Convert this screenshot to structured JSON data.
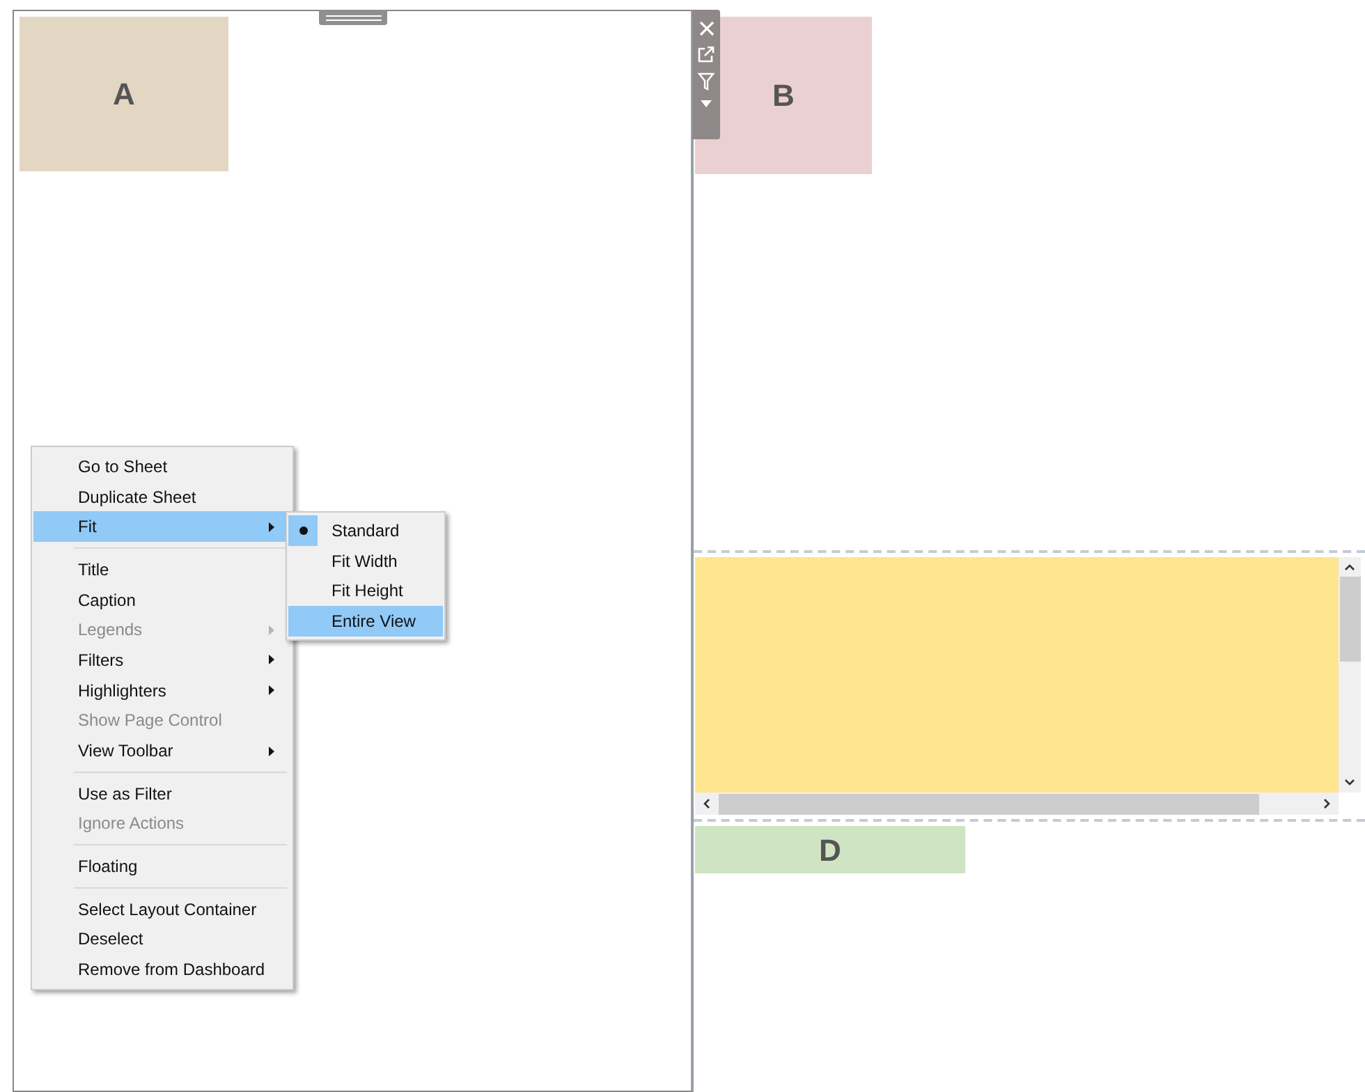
{
  "tiles": [
    {
      "label": "A",
      "color": "#e3d6c2"
    },
    {
      "label": "B",
      "color": "#ebd0d1"
    },
    {
      "label": "D",
      "color": "#cfe4c3"
    }
  ],
  "yellow_view": {
    "color": "#fee590"
  },
  "context_menu": [
    {
      "kind": "item",
      "label": "Go to Sheet",
      "disabled": false,
      "submenu": false,
      "selected": false
    },
    {
      "kind": "item",
      "label": "Duplicate Sheet",
      "disabled": false,
      "submenu": false,
      "selected": false
    },
    {
      "kind": "item",
      "label": "Fit",
      "disabled": false,
      "submenu": true,
      "selected": true
    },
    {
      "kind": "separator"
    },
    {
      "kind": "item",
      "label": "Title",
      "disabled": false,
      "submenu": false,
      "selected": false
    },
    {
      "kind": "item",
      "label": "Caption",
      "disabled": false,
      "submenu": false,
      "selected": false
    },
    {
      "kind": "item",
      "label": "Legends",
      "disabled": true,
      "submenu": true,
      "selected": false
    },
    {
      "kind": "item",
      "label": "Filters",
      "disabled": false,
      "submenu": true,
      "selected": false
    },
    {
      "kind": "item",
      "label": "Highlighters",
      "disabled": false,
      "submenu": true,
      "selected": false
    },
    {
      "kind": "item",
      "label": "Show Page Control",
      "disabled": true,
      "submenu": false,
      "selected": false
    },
    {
      "kind": "item",
      "label": "View Toolbar",
      "disabled": false,
      "submenu": true,
      "selected": false
    },
    {
      "kind": "separator"
    },
    {
      "kind": "item",
      "label": "Use as Filter",
      "disabled": false,
      "submenu": false,
      "selected": false
    },
    {
      "kind": "item",
      "label": "Ignore Actions",
      "disabled": true,
      "submenu": false,
      "selected": false
    },
    {
      "kind": "separator"
    },
    {
      "kind": "item",
      "label": "Floating",
      "disabled": false,
      "submenu": false,
      "selected": false
    },
    {
      "kind": "separator"
    },
    {
      "kind": "item",
      "label": "Select Layout Container",
      "disabled": false,
      "submenu": false,
      "selected": false
    },
    {
      "kind": "item",
      "label": "Deselect",
      "disabled": false,
      "submenu": false,
      "selected": false
    },
    {
      "kind": "item",
      "label": "Remove from Dashboard",
      "disabled": false,
      "submenu": false,
      "selected": false
    }
  ],
  "fit_submenu": [
    {
      "label": "Standard",
      "checked": true,
      "selected": false
    },
    {
      "label": "Fit Width",
      "checked": false,
      "selected": false
    },
    {
      "label": "Fit Height",
      "checked": false,
      "selected": false
    },
    {
      "label": "Entire View",
      "checked": false,
      "selected": true
    }
  ]
}
